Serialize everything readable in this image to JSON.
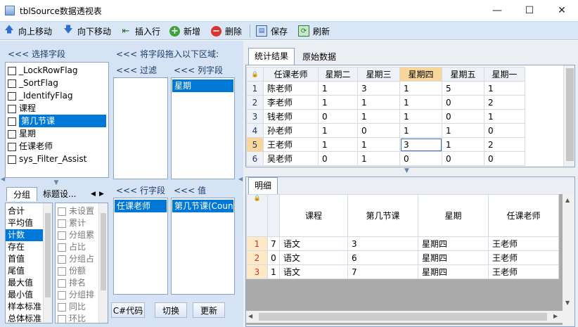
{
  "window": {
    "title": "tblSource数据透视表",
    "min": "—",
    "max": "☐",
    "close": "✕"
  },
  "toolbar": {
    "up": "向上移动",
    "down": "向下移动",
    "insert": "插入行",
    "add": "新增",
    "delete": "删除",
    "save": "保存",
    "refresh": "刷新"
  },
  "select_fields": {
    "header": "<<< 选择字段",
    "items": [
      "_LockRowFlag",
      "_SortFlag",
      "_IdentifyFlag",
      "课程",
      "第几节课",
      "星期",
      "任课老师",
      "sys_Filter_Assist"
    ],
    "selected_index": 4
  },
  "drag_hint": "<<< 将字段拖入以下区域:",
  "filter_header": "<<< 过滤",
  "col_header": "<<< 列字段",
  "col_items": [
    "星期"
  ],
  "row_header": "<<< 行字段",
  "row_items": [
    "任课老师"
  ],
  "val_header": "<<< 值",
  "val_items": [
    "第几节课(Count"
  ],
  "group_tabs": {
    "group": "分组",
    "title_settings": "标题设..."
  },
  "agg_list": [
    "合计",
    "平均值",
    "计数",
    "存在",
    "首值",
    "尾值",
    "最大值",
    "最小值",
    "样本标准",
    "总体标准"
  ],
  "agg_selected_index": 2,
  "options_list": [
    "未设置",
    "累计",
    "分组累",
    "占比",
    "分组占",
    "份额",
    "排名",
    "分组排",
    "同比",
    "环比"
  ],
  "buttons": {
    "code": "C#代码",
    "switch": "切换",
    "update": "更新"
  },
  "result_tabs": {
    "stats": "统计结果",
    "raw": "原始数据"
  },
  "pivot": {
    "columns": [
      "任课老师",
      "星期二",
      "星期三",
      "星期四",
      "星期五",
      "星期一"
    ],
    "rows": [
      [
        "陈老师",
        "1",
        "3",
        "1",
        "5",
        "1"
      ],
      [
        "李老师",
        "1",
        "1",
        "1",
        "0",
        "2"
      ],
      [
        "钱老师",
        "0",
        "1",
        "1",
        "0",
        "1"
      ],
      [
        "孙老师",
        "1",
        "0",
        "1",
        "1",
        "0"
      ],
      [
        "王老师",
        "1",
        "1",
        "3",
        "1",
        "2"
      ],
      [
        "吴老师",
        "0",
        "1",
        "0",
        "0",
        "0"
      ]
    ],
    "row_numbers": [
      "1",
      "2",
      "3",
      "4",
      "5",
      "6"
    ]
  },
  "detail_tab": "明细",
  "detail": {
    "columns": [
      "课程",
      "第几节课",
      "星期",
      "任课老师"
    ],
    "rows": [
      {
        "num": "1",
        "id": "7",
        "cells": [
          "语文",
          "3",
          "星期四",
          "王老师"
        ]
      },
      {
        "num": "2",
        "id": "0",
        "cells": [
          "语文",
          "6",
          "星期四",
          "王老师"
        ]
      },
      {
        "num": "3",
        "id": "1",
        "cells": [
          "语文",
          "7",
          "星期四",
          "王老师"
        ]
      }
    ]
  }
}
